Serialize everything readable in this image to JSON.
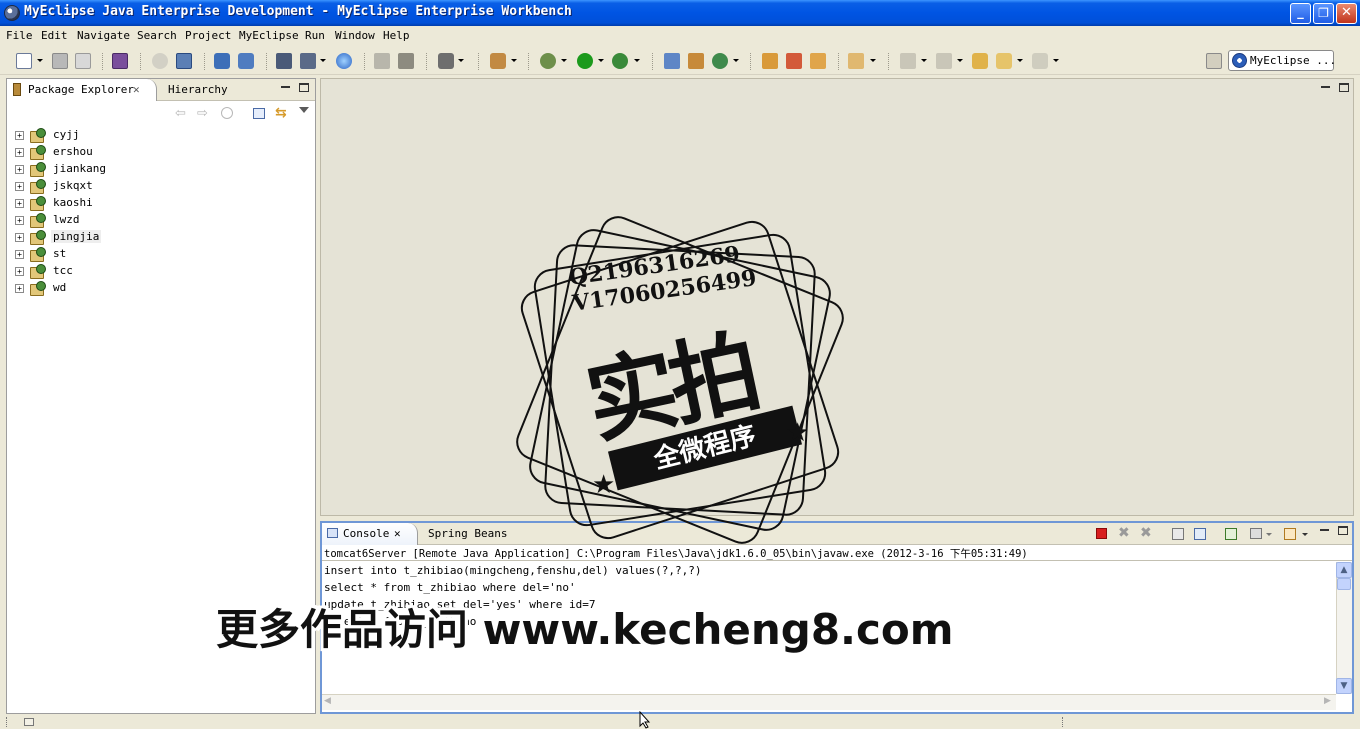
{
  "window": {
    "title": "MyEclipse Java Enterprise Development - MyEclipse Enterprise Workbench",
    "minimize": "_",
    "restore": "❐",
    "close": "✕"
  },
  "menu": [
    "File",
    "Edit",
    "Navigate",
    "Search",
    "Project",
    "MyEclipse",
    "Run",
    "Window",
    "Help"
  ],
  "perspective": {
    "label": "MyEclipse ..."
  },
  "left_panel": {
    "tabs": [
      "Package Explorer",
      "Hierarchy"
    ],
    "tab_close": "✕",
    "projects": [
      "cyjj",
      "ershou",
      "jiankang",
      "jskqxt",
      "kaoshi",
      "lwzd",
      "pingjia",
      "st",
      "tcc",
      "wd"
    ],
    "selected_project": "pingjia",
    "expand_glyph": "+"
  },
  "console_panel": {
    "tabs": [
      "Console",
      "Spring Beans"
    ],
    "tab_close": "✕",
    "header": "tomcat6Server [Remote Java Application] C:\\Program Files\\Java\\jdk1.6.0_05\\bin\\javaw.exe (2012-3-16 下午05:31:49)",
    "lines": [
      "insert into t_zhibiao(mingcheng,fenshu,del) values(?,?,?)",
      "select * from t_zhibiao where del='no'",
      "update t_zhibiao set del='yes' where id=7",
      "select * from t_zhibiao"
    ]
  },
  "watermark": {
    "stamp_lines": [
      "Q2196316269",
      "V17060256499"
    ],
    "stamp_big": "实拍",
    "stamp_ribbon": "全微程序",
    "banner": "更多作品访问 www.kecheng8.com"
  },
  "colors": {
    "title_bar": "#0054e3",
    "console_border": "#6f97d6",
    "run_green": "#1c9a1c",
    "stop_red": "#d81e1e"
  }
}
